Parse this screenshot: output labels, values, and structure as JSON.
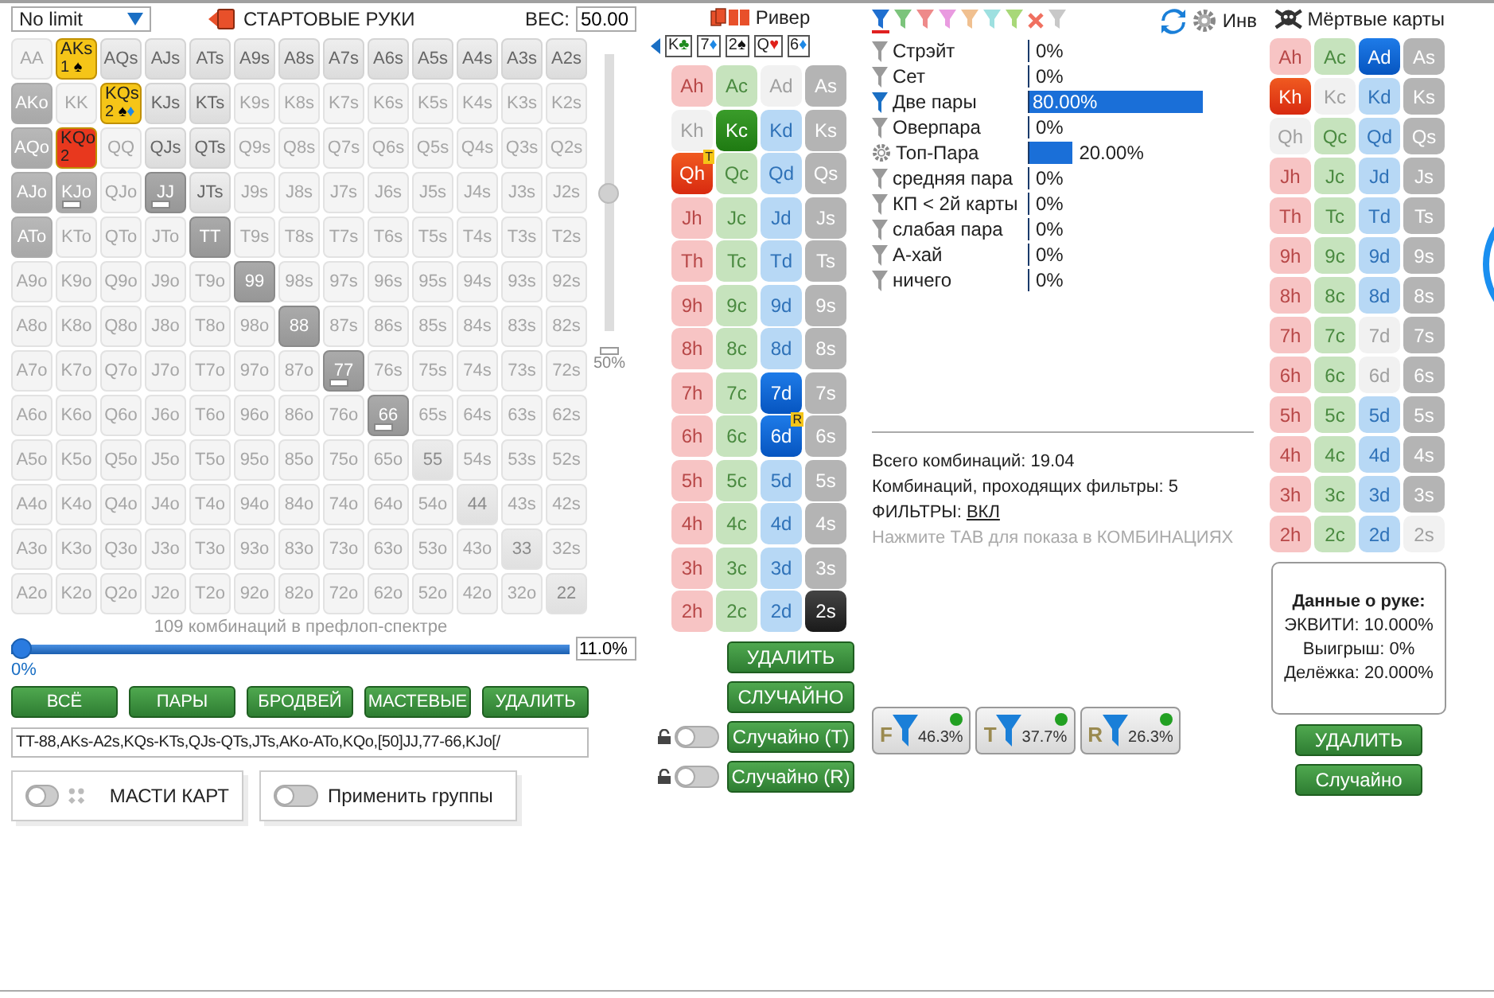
{
  "left": {
    "game_select": "No limit",
    "title": "СТАРТОВЫЕ РУКИ",
    "weight_label": "ВЕС:",
    "weight_value": "50.00",
    "weight_slider": {
      "level": 0.5,
      "reading": "50%"
    },
    "hand_grid": {
      "rows": [
        [
          {
            "label": "AA",
            "kind": "off"
          },
          {
            "label": "AKs",
            "kind": "group",
            "color": "#f5c518",
            "count": "1",
            "suits": [
              {
                "symbol": "♠",
                "color": "#000000"
              }
            ]
          },
          {
            "label": "AQs",
            "kind": "in"
          },
          {
            "label": "AJs",
            "kind": "in"
          },
          {
            "label": "ATs",
            "kind": "in"
          },
          {
            "label": "A9s",
            "kind": "in"
          },
          {
            "label": "A8s",
            "kind": "in"
          },
          {
            "label": "A7s",
            "kind": "in"
          },
          {
            "label": "A6s",
            "kind": "in"
          },
          {
            "label": "A5s",
            "kind": "in"
          },
          {
            "label": "A4s",
            "kind": "in"
          },
          {
            "label": "A3s",
            "kind": "in"
          },
          {
            "label": "A2s",
            "kind": "in"
          }
        ],
        [
          {
            "label": "AKo",
            "kind": "mid"
          },
          {
            "label": "KK",
            "kind": "off"
          },
          {
            "label": "KQs",
            "kind": "group",
            "color": "#f5c518",
            "count": "2",
            "suits": [
              {
                "symbol": "♠",
                "color": "#000000"
              },
              {
                "symbol": "♦",
                "color": "#1e88e5"
              }
            ]
          },
          {
            "label": "KJs",
            "kind": "in"
          },
          {
            "label": "KTs",
            "kind": "in"
          },
          {
            "label": "K9s",
            "kind": "off"
          },
          {
            "label": "K8s",
            "kind": "off"
          },
          {
            "label": "K7s",
            "kind": "off"
          },
          {
            "label": "K6s",
            "kind": "off"
          },
          {
            "label": "K5s",
            "kind": "off"
          },
          {
            "label": "K4s",
            "kind": "off"
          },
          {
            "label": "K3s",
            "kind": "off"
          },
          {
            "label": "K2s",
            "kind": "off"
          }
        ],
        [
          {
            "label": "AQo",
            "kind": "mid"
          },
          {
            "label": "KQo",
            "kind": "group",
            "color": "#e8381e",
            "count": "2"
          },
          {
            "label": "QQ",
            "kind": "off"
          },
          {
            "label": "QJs",
            "kind": "in"
          },
          {
            "label": "QTs",
            "kind": "in"
          },
          {
            "label": "Q9s",
            "kind": "off"
          },
          {
            "label": "Q8s",
            "kind": "off"
          },
          {
            "label": "Q7s",
            "kind": "off"
          },
          {
            "label": "Q6s",
            "kind": "off"
          },
          {
            "label": "Q5s",
            "kind": "off"
          },
          {
            "label": "Q4s",
            "kind": "off"
          },
          {
            "label": "Q3s",
            "kind": "off"
          },
          {
            "label": "Q2s",
            "kind": "off"
          }
        ],
        [
          {
            "label": "AJo",
            "kind": "mid"
          },
          {
            "label": "KJo",
            "kind": "mid",
            "partial": true
          },
          {
            "label": "QJo",
            "kind": "off"
          },
          {
            "label": "JJ",
            "kind": "dark",
            "partial": true
          },
          {
            "label": "JTs",
            "kind": "in"
          },
          {
            "label": "J9s",
            "kind": "off"
          },
          {
            "label": "J8s",
            "kind": "off"
          },
          {
            "label": "J7s",
            "kind": "off"
          },
          {
            "label": "J6s",
            "kind": "off"
          },
          {
            "label": "J5s",
            "kind": "off"
          },
          {
            "label": "J4s",
            "kind": "off"
          },
          {
            "label": "J3s",
            "kind": "off"
          },
          {
            "label": "J2s",
            "kind": "off"
          }
        ],
        [
          {
            "label": "ATo",
            "kind": "mid"
          },
          {
            "label": "KTo",
            "kind": "off"
          },
          {
            "label": "QTo",
            "kind": "off"
          },
          {
            "label": "JTo",
            "kind": "off"
          },
          {
            "label": "TT",
            "kind": "dark"
          },
          {
            "label": "T9s",
            "kind": "off"
          },
          {
            "label": "T8s",
            "kind": "off"
          },
          {
            "label": "T7s",
            "kind": "off"
          },
          {
            "label": "T6s",
            "kind": "off"
          },
          {
            "label": "T5s",
            "kind": "off"
          },
          {
            "label": "T4s",
            "kind": "off"
          },
          {
            "label": "T3s",
            "kind": "off"
          },
          {
            "label": "T2s",
            "kind": "off"
          }
        ],
        [
          {
            "label": "A9o",
            "kind": "off"
          },
          {
            "label": "K9o",
            "kind": "off"
          },
          {
            "label": "Q9o",
            "kind": "off"
          },
          {
            "label": "J9o",
            "kind": "off"
          },
          {
            "label": "T9o",
            "kind": "off"
          },
          {
            "label": "99",
            "kind": "dark"
          },
          {
            "label": "98s",
            "kind": "off"
          },
          {
            "label": "97s",
            "kind": "off"
          },
          {
            "label": "96s",
            "kind": "off"
          },
          {
            "label": "95s",
            "kind": "off"
          },
          {
            "label": "94s",
            "kind": "off"
          },
          {
            "label": "93s",
            "kind": "off"
          },
          {
            "label": "92s",
            "kind": "off"
          }
        ],
        [
          {
            "label": "A8o",
            "kind": "off"
          },
          {
            "label": "K8o",
            "kind": "off"
          },
          {
            "label": "Q8o",
            "kind": "off"
          },
          {
            "label": "J8o",
            "kind": "off"
          },
          {
            "label": "T8o",
            "kind": "off"
          },
          {
            "label": "98o",
            "kind": "off"
          },
          {
            "label": "88",
            "kind": "dark"
          },
          {
            "label": "87s",
            "kind": "off"
          },
          {
            "label": "86s",
            "kind": "off"
          },
          {
            "label": "85s",
            "kind": "off"
          },
          {
            "label": "84s",
            "kind": "off"
          },
          {
            "label": "83s",
            "kind": "off"
          },
          {
            "label": "82s",
            "kind": "off"
          }
        ],
        [
          {
            "label": "A7o",
            "kind": "off"
          },
          {
            "label": "K7o",
            "kind": "off"
          },
          {
            "label": "Q7o",
            "kind": "off"
          },
          {
            "label": "J7o",
            "kind": "off"
          },
          {
            "label": "T7o",
            "kind": "off"
          },
          {
            "label": "97o",
            "kind": "off"
          },
          {
            "label": "87o",
            "kind": "off"
          },
          {
            "label": "77",
            "kind": "dark",
            "partial": true
          },
          {
            "label": "76s",
            "kind": "off"
          },
          {
            "label": "75s",
            "kind": "off"
          },
          {
            "label": "74s",
            "kind": "off"
          },
          {
            "label": "73s",
            "kind": "off"
          },
          {
            "label": "72s",
            "kind": "off"
          }
        ],
        [
          {
            "label": "A6o",
            "kind": "off"
          },
          {
            "label": "K6o",
            "kind": "off"
          },
          {
            "label": "Q6o",
            "kind": "off"
          },
          {
            "label": "J6o",
            "kind": "off"
          },
          {
            "label": "T6o",
            "kind": "off"
          },
          {
            "label": "96o",
            "kind": "off"
          },
          {
            "label": "86o",
            "kind": "off"
          },
          {
            "label": "76o",
            "kind": "off"
          },
          {
            "label": "66",
            "kind": "dark",
            "partial": true
          },
          {
            "label": "65s",
            "kind": "off"
          },
          {
            "label": "64s",
            "kind": "off"
          },
          {
            "label": "63s",
            "kind": "off"
          },
          {
            "label": "62s",
            "kind": "off"
          }
        ],
        [
          {
            "label": "A5o",
            "kind": "off"
          },
          {
            "label": "K5o",
            "kind": "off"
          },
          {
            "label": "Q5o",
            "kind": "off"
          },
          {
            "label": "J5o",
            "kind": "off"
          },
          {
            "label": "T5o",
            "kind": "off"
          },
          {
            "label": "95o",
            "kind": "off"
          },
          {
            "label": "85o",
            "kind": "off"
          },
          {
            "label": "75o",
            "kind": "off"
          },
          {
            "label": "65o",
            "kind": "off"
          },
          {
            "label": "55",
            "kind": "light"
          },
          {
            "label": "54s",
            "kind": "off"
          },
          {
            "label": "53s",
            "kind": "off"
          },
          {
            "label": "52s",
            "kind": "off"
          }
        ],
        [
          {
            "label": "A4o",
            "kind": "off"
          },
          {
            "label": "K4o",
            "kind": "off"
          },
          {
            "label": "Q4o",
            "kind": "off"
          },
          {
            "label": "J4o",
            "kind": "off"
          },
          {
            "label": "T4o",
            "kind": "off"
          },
          {
            "label": "94o",
            "kind": "off"
          },
          {
            "label": "84o",
            "kind": "off"
          },
          {
            "label": "74o",
            "kind": "off"
          },
          {
            "label": "64o",
            "kind": "off"
          },
          {
            "label": "54o",
            "kind": "off"
          },
          {
            "label": "44",
            "kind": "light"
          },
          {
            "label": "43s",
            "kind": "off"
          },
          {
            "label": "42s",
            "kind": "off"
          }
        ],
        [
          {
            "label": "A3o",
            "kind": "off"
          },
          {
            "label": "K3o",
            "kind": "off"
          },
          {
            "label": "Q3o",
            "kind": "off"
          },
          {
            "label": "J3o",
            "kind": "off"
          },
          {
            "label": "T3o",
            "kind": "off"
          },
          {
            "label": "93o",
            "kind": "off"
          },
          {
            "label": "83o",
            "kind": "off"
          },
          {
            "label": "73o",
            "kind": "off"
          },
          {
            "label": "63o",
            "kind": "off"
          },
          {
            "label": "53o",
            "kind": "off"
          },
          {
            "label": "43o",
            "kind": "off"
          },
          {
            "label": "33",
            "kind": "light"
          },
          {
            "label": "32s",
            "kind": "off"
          }
        ],
        [
          {
            "label": "A2o",
            "kind": "off"
          },
          {
            "label": "K2o",
            "kind": "off"
          },
          {
            "label": "Q2o",
            "kind": "off"
          },
          {
            "label": "J2o",
            "kind": "off"
          },
          {
            "label": "T2o",
            "kind": "off"
          },
          {
            "label": "92o",
            "kind": "off"
          },
          {
            "label": "82o",
            "kind": "off"
          },
          {
            "label": "72o",
            "kind": "off"
          },
          {
            "label": "62o",
            "kind": "off"
          },
          {
            "label": "52o",
            "kind": "off"
          },
          {
            "label": "42o",
            "kind": "off"
          },
          {
            "label": "32o",
            "kind": "off"
          },
          {
            "label": "22",
            "kind": "light"
          }
        ]
      ]
    },
    "combos_caption": "109 комбинаций в префлоп-спектре",
    "range_slider": {
      "level": 0,
      "reading": "0%",
      "value": "11.0%"
    },
    "buttons": [
      "ВСЁ",
      "ПАРЫ",
      "БРОДВЕЙ",
      "МАСТЕВЫЕ",
      "УДАЛИТЬ"
    ],
    "range_text": "TT-88,AKs-A2s,KQs-KTs,QJs-QTs,JTs,AKo-ATo,KQo,[50]JJ,77-66,KJo[/",
    "toggles": [
      {
        "kind": "suits",
        "label": "МАСТИ КАРТ",
        "on": false
      },
      {
        "kind": "plain",
        "label": "Применить группы",
        "on": false
      }
    ]
  },
  "board": {
    "title": "Ривер",
    "cards": [
      {
        "rank": "K",
        "symbol": "♣",
        "color": "#1f8a1f"
      },
      {
        "rank": "7",
        "symbol": "♦",
        "color": "#1e88e5"
      },
      {
        "rank": "2",
        "symbol": "♠",
        "color": "#111111"
      },
      {
        "rank": "Q",
        "symbol": "♥",
        "color": "#e0201a"
      },
      {
        "rank": "6",
        "symbol": "♦",
        "color": "#1e88e5"
      }
    ],
    "deck": [
      [
        {
          "label": "Ah",
          "kind": "hearts",
          "picked": false,
          "blocked": false
        },
        {
          "label": "Ac",
          "kind": "clubs",
          "picked": false,
          "blocked": false
        },
        {
          "label": "Ad",
          "kind": "diamonds",
          "picked": false,
          "blocked": true
        },
        {
          "label": "As",
          "kind": "spades",
          "picked": false,
          "blocked": false
        }
      ],
      [
        {
          "label": "Kh",
          "kind": "hearts",
          "picked": false,
          "blocked": true
        },
        {
          "label": "Kc",
          "kind": "clubs",
          "picked": true,
          "blocked": false
        },
        {
          "label": "Kd",
          "kind": "diamonds",
          "picked": false,
          "blocked": false
        },
        {
          "label": "Ks",
          "kind": "spades",
          "picked": false,
          "blocked": false
        }
      ],
      [
        {
          "label": "Qh",
          "kind": "hearts",
          "picked": true,
          "blocked": false,
          "badge": "T"
        },
        {
          "label": "Qc",
          "kind": "clubs",
          "picked": false,
          "blocked": false
        },
        {
          "label": "Qd",
          "kind": "diamonds",
          "picked": false,
          "blocked": false
        },
        {
          "label": "Qs",
          "kind": "spades",
          "picked": false,
          "blocked": false
        }
      ],
      [
        {
          "label": "Jh",
          "kind": "hearts",
          "picked": false,
          "blocked": false
        },
        {
          "label": "Jc",
          "kind": "clubs",
          "picked": false,
          "blocked": false
        },
        {
          "label": "Jd",
          "kind": "diamonds",
          "picked": false,
          "blocked": false
        },
        {
          "label": "Js",
          "kind": "spades",
          "picked": false,
          "blocked": false
        }
      ],
      [
        {
          "label": "Th",
          "kind": "hearts",
          "picked": false,
          "blocked": false
        },
        {
          "label": "Tc",
          "kind": "clubs",
          "picked": false,
          "blocked": false
        },
        {
          "label": "Td",
          "kind": "diamonds",
          "picked": false,
          "blocked": false
        },
        {
          "label": "Ts",
          "kind": "spades",
          "picked": false,
          "blocked": false
        }
      ],
      [
        {
          "label": "9h",
          "kind": "hearts",
          "picked": false,
          "blocked": false
        },
        {
          "label": "9c",
          "kind": "clubs",
          "picked": false,
          "blocked": false
        },
        {
          "label": "9d",
          "kind": "diamonds",
          "picked": false,
          "blocked": false
        },
        {
          "label": "9s",
          "kind": "spades",
          "picked": false,
          "blocked": false
        }
      ],
      [
        {
          "label": "8h",
          "kind": "hearts",
          "picked": false,
          "blocked": false
        },
        {
          "label": "8c",
          "kind": "clubs",
          "picked": false,
          "blocked": false
        },
        {
          "label": "8d",
          "kind": "diamonds",
          "picked": false,
          "blocked": false
        },
        {
          "label": "8s",
          "kind": "spades",
          "picked": false,
          "blocked": false
        }
      ],
      [
        {
          "label": "7h",
          "kind": "hearts",
          "picked": false,
          "blocked": false
        },
        {
          "label": "7c",
          "kind": "clubs",
          "picked": false,
          "blocked": false
        },
        {
          "label": "7d",
          "kind": "diamonds",
          "picked": true,
          "blocked": false
        },
        {
          "label": "7s",
          "kind": "spades",
          "picked": false,
          "blocked": false
        }
      ],
      [
        {
          "label": "6h",
          "kind": "hearts",
          "picked": false,
          "blocked": false
        },
        {
          "label": "6c",
          "kind": "clubs",
          "picked": false,
          "blocked": false
        },
        {
          "label": "6d",
          "kind": "diamonds",
          "picked": true,
          "blocked": false,
          "badge": "R"
        },
        {
          "label": "6s",
          "kind": "spades",
          "picked": false,
          "blocked": false
        }
      ],
      [
        {
          "label": "5h",
          "kind": "hearts",
          "picked": false,
          "blocked": false
        },
        {
          "label": "5c",
          "kind": "clubs",
          "picked": false,
          "blocked": false
        },
        {
          "label": "5d",
          "kind": "diamonds",
          "picked": false,
          "blocked": false
        },
        {
          "label": "5s",
          "kind": "spades",
          "picked": false,
          "blocked": false
        }
      ],
      [
        {
          "label": "4h",
          "kind": "hearts",
          "picked": false,
          "blocked": false
        },
        {
          "label": "4c",
          "kind": "clubs",
          "picked": false,
          "blocked": false
        },
        {
          "label": "4d",
          "kind": "diamonds",
          "picked": false,
          "blocked": false
        },
        {
          "label": "4s",
          "kind": "spades",
          "picked": false,
          "blocked": false
        }
      ],
      [
        {
          "label": "3h",
          "kind": "hearts",
          "picked": false,
          "blocked": false
        },
        {
          "label": "3c",
          "kind": "clubs",
          "picked": false,
          "blocked": false
        },
        {
          "label": "3d",
          "kind": "diamonds",
          "picked": false,
          "blocked": false
        },
        {
          "label": "3s",
          "kind": "spades",
          "picked": false,
          "blocked": false
        }
      ],
      [
        {
          "label": "2h",
          "kind": "hearts",
          "picked": false,
          "blocked": false
        },
        {
          "label": "2c",
          "kind": "clubs",
          "picked": false,
          "blocked": false
        },
        {
          "label": "2d",
          "kind": "diamonds",
          "picked": false,
          "blocked": false
        },
        {
          "label": "2s",
          "kind": "spades",
          "picked": true,
          "blocked": false
        }
      ]
    ],
    "buttons": [
      "УДАЛИТЬ",
      "СЛУЧАЙНО"
    ],
    "random_buttons": [
      {
        "label": "Случайно (T)",
        "on": false
      },
      {
        "label": "Случайно (R)",
        "on": false
      }
    ]
  },
  "filters": {
    "tabs": [
      {
        "kind": "funnel",
        "color": "#1f6fd0",
        "selected": true
      },
      {
        "kind": "funnel",
        "color": "#7cc47c",
        "selected": false
      },
      {
        "kind": "funnel",
        "color": "#ee8a8a",
        "selected": false
      },
      {
        "kind": "funnel",
        "color": "#e99be0",
        "selected": false
      },
      {
        "kind": "funnel",
        "color": "#f0c090",
        "selected": false
      },
      {
        "kind": "funnel",
        "color": "#9ee0e0",
        "selected": false
      },
      {
        "kind": "funnel",
        "color": "#a8d878",
        "selected": false
      },
      {
        "kind": "clear",
        "color": "#f07060",
        "selected": false
      },
      {
        "kind": "funnel",
        "color": "#c8c8c8",
        "selected": false
      }
    ],
    "invert_label": "Инв",
    "rows": [
      {
        "kind": "funnel",
        "active": false,
        "label": "Стрэйт",
        "reading": "0%"
      },
      {
        "kind": "funnel",
        "active": false,
        "label": "Сет",
        "reading": "0%"
      },
      {
        "kind": "funnel",
        "active": true,
        "label": "Две пары",
        "level": 0.8,
        "reading": "80.00%"
      },
      {
        "kind": "funnel",
        "active": false,
        "label": "Оверпара",
        "reading": "0%"
      },
      {
        "kind": "gear",
        "active": false,
        "label": "Топ-Пара",
        "level": 0.2,
        "reading": "20.00%"
      },
      {
        "kind": "funnel",
        "active": false,
        "label": "средняя пара",
        "reading": "0%"
      },
      {
        "kind": "funnel",
        "active": false,
        "label": "КП < 2й карты",
        "reading": "0%"
      },
      {
        "kind": "funnel",
        "active": false,
        "label": "слабая пара",
        "reading": "0%"
      },
      {
        "kind": "funnel",
        "active": false,
        "label": "А-хай",
        "reading": "0%"
      },
      {
        "kind": "funnel",
        "active": false,
        "label": "ничего",
        "reading": "0%"
      }
    ],
    "total": "Всего комбинаций: 19.04",
    "passing": "Комбинаций, проходящих фильтры: 5",
    "filters_label": "ФИЛЬТРЫ:",
    "filters_link": "ВКЛ",
    "hint": "Нажмите ТАВ для показа в КОМБИНАЦИЯХ",
    "badges": [
      {
        "letter": "F",
        "reading": "46.3%",
        "on": true
      },
      {
        "letter": "T",
        "reading": "37.7%",
        "on": true
      },
      {
        "letter": "R",
        "reading": "26.3%",
        "on": true
      }
    ]
  },
  "dead": {
    "title": "Мёртвые карты",
    "deck": [
      [
        {
          "label": "Ah",
          "kind": "hearts",
          "picked": false,
          "blocked": false
        },
        {
          "label": "Ac",
          "kind": "clubs",
          "picked": false,
          "blocked": false
        },
        {
          "label": "Ad",
          "kind": "diamonds",
          "picked": true,
          "blocked": false
        },
        {
          "label": "As",
          "kind": "spades",
          "picked": false,
          "blocked": false
        }
      ],
      [
        {
          "label": "Kh",
          "kind": "hearts",
          "picked": true,
          "blocked": false
        },
        {
          "label": "Kc",
          "kind": "clubs",
          "picked": false,
          "blocked": true
        },
        {
          "label": "Kd",
          "kind": "diamonds",
          "picked": false,
          "blocked": false
        },
        {
          "label": "Ks",
          "kind": "spades",
          "picked": false,
          "blocked": false
        }
      ],
      [
        {
          "label": "Qh",
          "kind": "hearts",
          "picked": false,
          "blocked": true
        },
        {
          "label": "Qc",
          "kind": "clubs",
          "picked": false,
          "blocked": false
        },
        {
          "label": "Qd",
          "kind": "diamonds",
          "picked": false,
          "blocked": false
        },
        {
          "label": "Qs",
          "kind": "spades",
          "picked": false,
          "blocked": false
        }
      ],
      [
        {
          "label": "Jh",
          "kind": "hearts",
          "picked": false,
          "blocked": false
        },
        {
          "label": "Jc",
          "kind": "clubs",
          "picked": false,
          "blocked": false
        },
        {
          "label": "Jd",
          "kind": "diamonds",
          "picked": false,
          "blocked": false
        },
        {
          "label": "Js",
          "kind": "spades",
          "picked": false,
          "blocked": false
        }
      ],
      [
        {
          "label": "Th",
          "kind": "hearts",
          "picked": false,
          "blocked": false
        },
        {
          "label": "Tc",
          "kind": "clubs",
          "picked": false,
          "blocked": false
        },
        {
          "label": "Td",
          "kind": "diamonds",
          "picked": false,
          "blocked": false
        },
        {
          "label": "Ts",
          "kind": "spades",
          "picked": false,
          "blocked": false
        }
      ],
      [
        {
          "label": "9h",
          "kind": "hearts",
          "picked": false,
          "blocked": false
        },
        {
          "label": "9c",
          "kind": "clubs",
          "picked": false,
          "blocked": false
        },
        {
          "label": "9d",
          "kind": "diamonds",
          "picked": false,
          "blocked": false
        },
        {
          "label": "9s",
          "kind": "spades",
          "picked": false,
          "blocked": false
        }
      ],
      [
        {
          "label": "8h",
          "kind": "hearts",
          "picked": false,
          "blocked": false
        },
        {
          "label": "8c",
          "kind": "clubs",
          "picked": false,
          "blocked": false
        },
        {
          "label": "8d",
          "kind": "diamonds",
          "picked": false,
          "blocked": false
        },
        {
          "label": "8s",
          "kind": "spades",
          "picked": false,
          "blocked": false
        }
      ],
      [
        {
          "label": "7h",
          "kind": "hearts",
          "picked": false,
          "blocked": false
        },
        {
          "label": "7c",
          "kind": "clubs",
          "picked": false,
          "blocked": false
        },
        {
          "label": "7d",
          "kind": "diamonds",
          "picked": false,
          "blocked": true
        },
        {
          "label": "7s",
          "kind": "spades",
          "picked": false,
          "blocked": false
        }
      ],
      [
        {
          "label": "6h",
          "kind": "hearts",
          "picked": false,
          "blocked": false
        },
        {
          "label": "6c",
          "kind": "clubs",
          "picked": false,
          "blocked": false
        },
        {
          "label": "6d",
          "kind": "diamonds",
          "picked": false,
          "blocked": true
        },
        {
          "label": "6s",
          "kind": "spades",
          "picked": false,
          "blocked": false
        }
      ],
      [
        {
          "label": "5h",
          "kind": "hearts",
          "picked": false,
          "blocked": false
        },
        {
          "label": "5c",
          "kind": "clubs",
          "picked": false,
          "blocked": false
        },
        {
          "label": "5d",
          "kind": "diamonds",
          "picked": false,
          "blocked": false
        },
        {
          "label": "5s",
          "kind": "spades",
          "picked": false,
          "blocked": false
        }
      ],
      [
        {
          "label": "4h",
          "kind": "hearts",
          "picked": false,
          "blocked": false
        },
        {
          "label": "4c",
          "kind": "clubs",
          "picked": false,
          "blocked": false
        },
        {
          "label": "4d",
          "kind": "diamonds",
          "picked": false,
          "blocked": false
        },
        {
          "label": "4s",
          "kind": "spades",
          "picked": false,
          "blocked": false
        }
      ],
      [
        {
          "label": "3h",
          "kind": "hearts",
          "picked": false,
          "blocked": false
        },
        {
          "label": "3c",
          "kind": "clubs",
          "picked": false,
          "blocked": false
        },
        {
          "label": "3d",
          "kind": "diamonds",
          "picked": false,
          "blocked": false
        },
        {
          "label": "3s",
          "kind": "spades",
          "picked": false,
          "blocked": false
        }
      ],
      [
        {
          "label": "2h",
          "kind": "hearts",
          "picked": false,
          "blocked": false
        },
        {
          "label": "2c",
          "kind": "clubs",
          "picked": false,
          "blocked": false
        },
        {
          "label": "2d",
          "kind": "diamonds",
          "picked": false,
          "blocked": false
        },
        {
          "label": "2s",
          "kind": "spades",
          "picked": false,
          "blocked": true
        }
      ]
    ],
    "hand_info": {
      "title": "Данные о руке:",
      "lines": [
        "ЭКВИТИ: 10.000%",
        "Выигрыш: 0%",
        "Делёжка: 20.000%"
      ]
    },
    "buttons": [
      "УДАЛИТЬ",
      "Случайно"
    ]
  }
}
